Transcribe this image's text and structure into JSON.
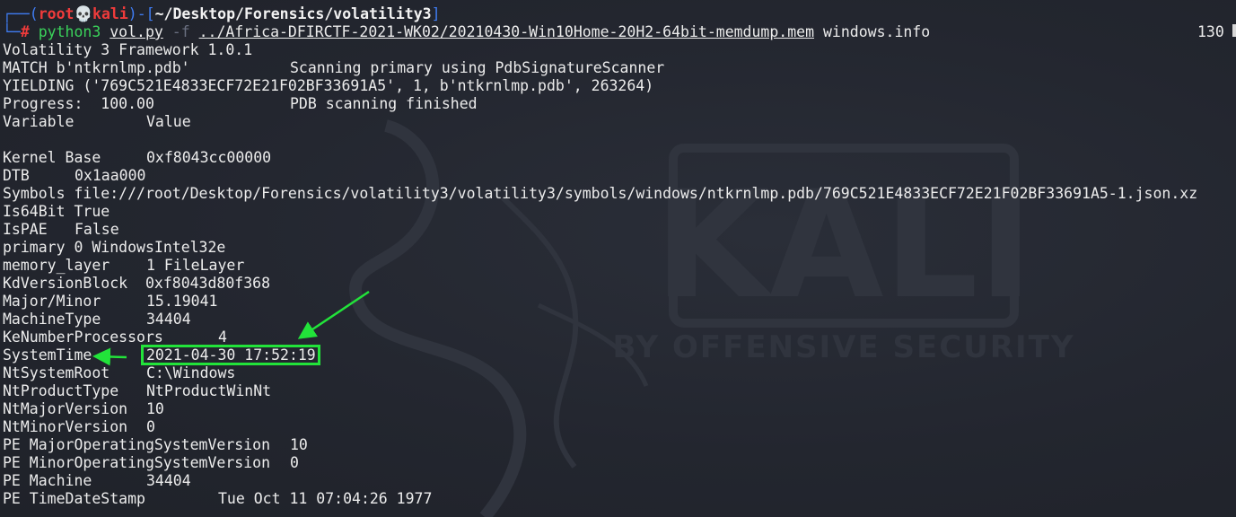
{
  "prompt": {
    "user": "root",
    "separator_icon": "skull-icon",
    "host": "kali",
    "path": "~/Desktop/Forensics/volatility3",
    "symbol": "#",
    "command": "python3",
    "script": "vol.py",
    "flag": "-f",
    "file": "../Africa-DFIRCTF-2021-WK02/20210430-Win10Home-20H2-64bit-memdump.mem",
    "plugin": "windows.info",
    "right_status": "130"
  },
  "output": {
    "framework": "Volatility 3 Framework 1.0.1",
    "match_key": "MATCH b'ntkrnlmp.pdb'",
    "match_msg": "Scanning primary using PdbSignatureScanner",
    "yielding": "YIELDING ('769C521E4833ECF72E21F02BF33691A5', 1, b'ntkrnlmp.pdb', 263264)",
    "progress_key": "Progress:  100.00",
    "progress_msg": "PDB scanning finished",
    "header_variable": "Variable",
    "header_value": "Value",
    "rows": [
      {
        "key": "Kernel Base",
        "value": "0xf8043cc00000"
      },
      {
        "key": "DTB",
        "value": "0x1aa000"
      },
      {
        "key": "Symbols",
        "value": "file:///root/Desktop/Forensics/volatility3/volatility3/symbols/windows/ntkrnlmp.pdb/769C521E4833ECF72E21F02BF33691A5-1.json.xz"
      },
      {
        "key": "Is64Bit",
        "value": "True"
      },
      {
        "key": "IsPAE",
        "value": "False"
      },
      {
        "key": "primary",
        "value": "0 WindowsIntel32e"
      },
      {
        "key": "memory_layer",
        "value": "1 FileLayer"
      },
      {
        "key": "KdVersionBlock",
        "value": "0xf8043d80f368"
      },
      {
        "key": "Major/Minor",
        "value": "15.19041"
      },
      {
        "key": "MachineType",
        "value": "34404"
      },
      {
        "key": "KeNumberProcessors",
        "value": "4"
      },
      {
        "key": "SystemTime",
        "value": "2021-04-30 17:52:19"
      },
      {
        "key": "NtSystemRoot",
        "value": "C:\\Windows"
      },
      {
        "key": "NtProductType",
        "value": "NtProductWinNt"
      },
      {
        "key": "NtMajorVersion",
        "value": "10"
      },
      {
        "key": "NtMinorVersion",
        "value": "0"
      },
      {
        "key": "PE MajorOperatingSystemVersion",
        "value": "10"
      },
      {
        "key": "PE MinorOperatingSystemVersion",
        "value": "0"
      },
      {
        "key": "PE Machine",
        "value": "34404"
      },
      {
        "key": "PE TimeDateStamp",
        "value": "Tue Oct 11 07:04:26 1977"
      }
    ]
  },
  "watermark": {
    "logo_text": "KALI",
    "tagline": "BY OFFENSIVE SECURITY"
  },
  "colors": {
    "background": "#23262f",
    "prompt_blue": "#3f7cf2",
    "prompt_red": "#ef3b3b",
    "command_green": "#3ad15a",
    "annotation_green": "#22e33a"
  }
}
